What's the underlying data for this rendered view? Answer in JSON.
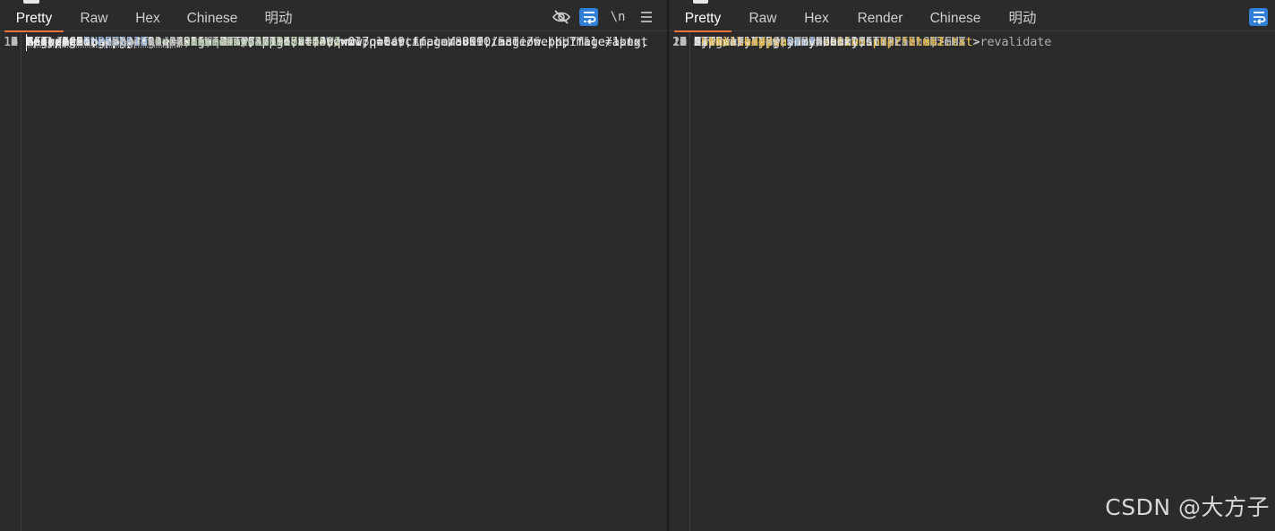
{
  "request": {
    "tabs": [
      "Pretty",
      "Raw",
      "Hex",
      "Chinese",
      "明动"
    ],
    "active_tab": "Pretty",
    "newline_toggle_label": "\\n",
    "line_numbers": [
      "1",
      "2",
      "3",
      "4",
      "",
      "5",
      "",
      "",
      "6",
      "",
      "7",
      "8",
      "9",
      "10",
      "11",
      "12"
    ],
    "lines": [
      {
        "method": "GET",
        "path": " /action.php?file=",
        "param": "1.txt",
        "proto": " HTTP/1.1"
      },
      {
        "key": "Host",
        "sep": ": ",
        "val": "06bb2bb2-39be-4825-a3eb-64b1917bff40.www.polarctf.com:8090"
      },
      {
        "key": "Upgrade-Insecure-Requests",
        "sep": ": ",
        "val": "1"
      },
      {
        "key": "User-Agent",
        "sep": ": ",
        "val": "Mozilla/5.0 (Windows NT 10.0; Win64; x64) AppleWebKit/537.36 (KHTML, like"
      },
      {
        "text": "Gecko) Chrome/144.0.0.0 Safari/537.36"
      },
      {
        "key": "Accept",
        "sep": ":",
        "val": ""
      },
      {
        "text": "text/html,application/xhtml+xml,application/xml;q=0.9,image/avif,image/webp,image/apng,"
      },
      {
        "text": "*/*;q=0.8,application/signed-exchange;v=b3;q=0.7"
      },
      {
        "key": "Referer",
        "sep": ":",
        "val": ""
      },
      {
        "text": "http://06bb2bb2-39be-4825-a3eb-64b1917bff40.www.polarctf.com:8090/action.php?file=1.txt"
      },
      {
        "key": "Accept-Encoding",
        "sep": ": ",
        "val": "gzip, deflate, br"
      },
      {
        "key": "Accept-Language",
        "sep": ": ",
        "val": "zh-CN,zh;q=0.9"
      },
      {
        "key": "Cookie",
        "sep": ": ",
        "cookie_name": "PHPSESSID",
        "cookie_eq": "=",
        "cookie_val": "vvccdnmkmo9kno2ad828370st1"
      },
      {
        "key": "Connection",
        "sep": ": ",
        "val": "keep-alive"
      },
      {
        "text": ""
      },
      {
        "text": ""
      }
    ]
  },
  "response": {
    "tabs": [
      "Pretty",
      "Raw",
      "Hex",
      "Render",
      "Chinese",
      "明动"
    ],
    "active_tab": "Pretty",
    "line_numbers": [
      "1",
      "2",
      "3",
      "4",
      "5",
      "6",
      "7",
      "8",
      "9",
      "10",
      "11",
      "12",
      "13",
      "14",
      "15",
      "16",
      "17",
      "18",
      "",
      "",
      "19",
      "",
      "",
      "20",
      "21"
    ],
    "lines": [
      {
        "text": "HTTP/1.1 200 OK"
      },
      {
        "key": "Cache-Control",
        "sep": ": ",
        "val": "no-store, no-cache, must-revalidate"
      },
      {
        "key": "Content-Length",
        "sep": ": ",
        "val": "189"
      },
      {
        "key": "Content-Type",
        "sep": ": ",
        "val": "text/html; charset=UTF-8"
      },
      {
        "key": "Date",
        "sep": ": ",
        "val": "Thu, 19 Mar 2026 15:12:17 GMT"
      },
      {
        "key": "Expires",
        "sep": ": ",
        "val": "Thu, 19 Nov 1981 08:52:00 GMT"
      },
      {
        "key": "Pragma",
        "sep": ": ",
        "val": "no-cache"
      },
      {
        "key": "Server",
        "sep": ": ",
        "val": "Apache/2.4.23 (Unix)"
      },
      {
        "key": "X-Powered-By",
        "sep": ": ",
        "val": "PHP/7.0.9"
      },
      {
        "text": ""
      },
      {
        "text": "my dairy"
      },
      {
        "text": ""
      },
      {
        "pre": "I won't show you hhh",
        "doctype": "<!DOCTYPE ",
        "dtname": "html",
        "dtend": ">"
      },
      {
        "html": [
          [
            "p",
            "<"
          ],
          [
            "y",
            "html"
          ],
          [
            "p",
            ">"
          ]
        ]
      },
      {
        "html": [
          [
            "p",
            "     <"
          ],
          [
            "y",
            "head"
          ],
          [
            "p",
            ">"
          ]
        ]
      },
      {
        "html": [
          [
            "p",
            "     </"
          ],
          [
            "y",
            "head"
          ],
          [
            "p",
            ">"
          ]
        ]
      },
      {
        "html": [
          [
            "p",
            "     <"
          ],
          [
            "y",
            "body"
          ],
          [
            "p",
            ">"
          ]
        ]
      },
      {
        "html": [
          [
            "p",
            "          <"
          ],
          [
            "y",
            "a"
          ],
          [
            "p",
            " "
          ],
          [
            "b",
            "href"
          ],
          [
            "p",
            "="
          ],
          [
            "y",
            "action.php?file=1.txt"
          ],
          [
            "p",
            ">"
          ]
        ]
      },
      {
        "text": "               my dairy"
      },
      {
        "html": [
          [
            "p",
            "          </"
          ],
          [
            "y",
            "a"
          ],
          [
            "p",
            ">"
          ]
        ]
      },
      {
        "html": [
          [
            "p",
            "          <"
          ],
          [
            "y",
            "a"
          ],
          [
            "p",
            " "
          ],
          [
            "b",
            "href"
          ],
          [
            "p",
            "="
          ],
          [
            "y",
            "action.php?file=2.txt"
          ],
          [
            "p",
            ">"
          ]
        ]
      },
      {
        "text": "               my booklist"
      },
      {
        "html": [
          [
            "p",
            "          </"
          ],
          [
            "y",
            "a"
          ],
          [
            "p",
            ">"
          ]
        ]
      },
      {
        "html": [
          [
            "p",
            "     </"
          ],
          [
            "y",
            "body"
          ],
          [
            "p",
            ">"
          ]
        ]
      },
      {
        "html": [
          [
            "p",
            "</"
          ],
          [
            "y",
            "html"
          ],
          [
            "p",
            ">"
          ]
        ]
      }
    ]
  },
  "watermark": "CSDN @大方子",
  "colors": {
    "accent_tab_underline": "#e8743b",
    "wrap_button": "#2f7fd6",
    "param_value": "#b5cea8",
    "tag_name": "#e0b84a",
    "attr_name": "#8fb3e3"
  },
  "icons": {
    "request_toolbar": [
      "eye-slash-icon",
      "wrap-lines-icon",
      "newline-icon",
      "menu-icon"
    ],
    "response_toolbar": [
      "wrap-lines-icon"
    ]
  }
}
